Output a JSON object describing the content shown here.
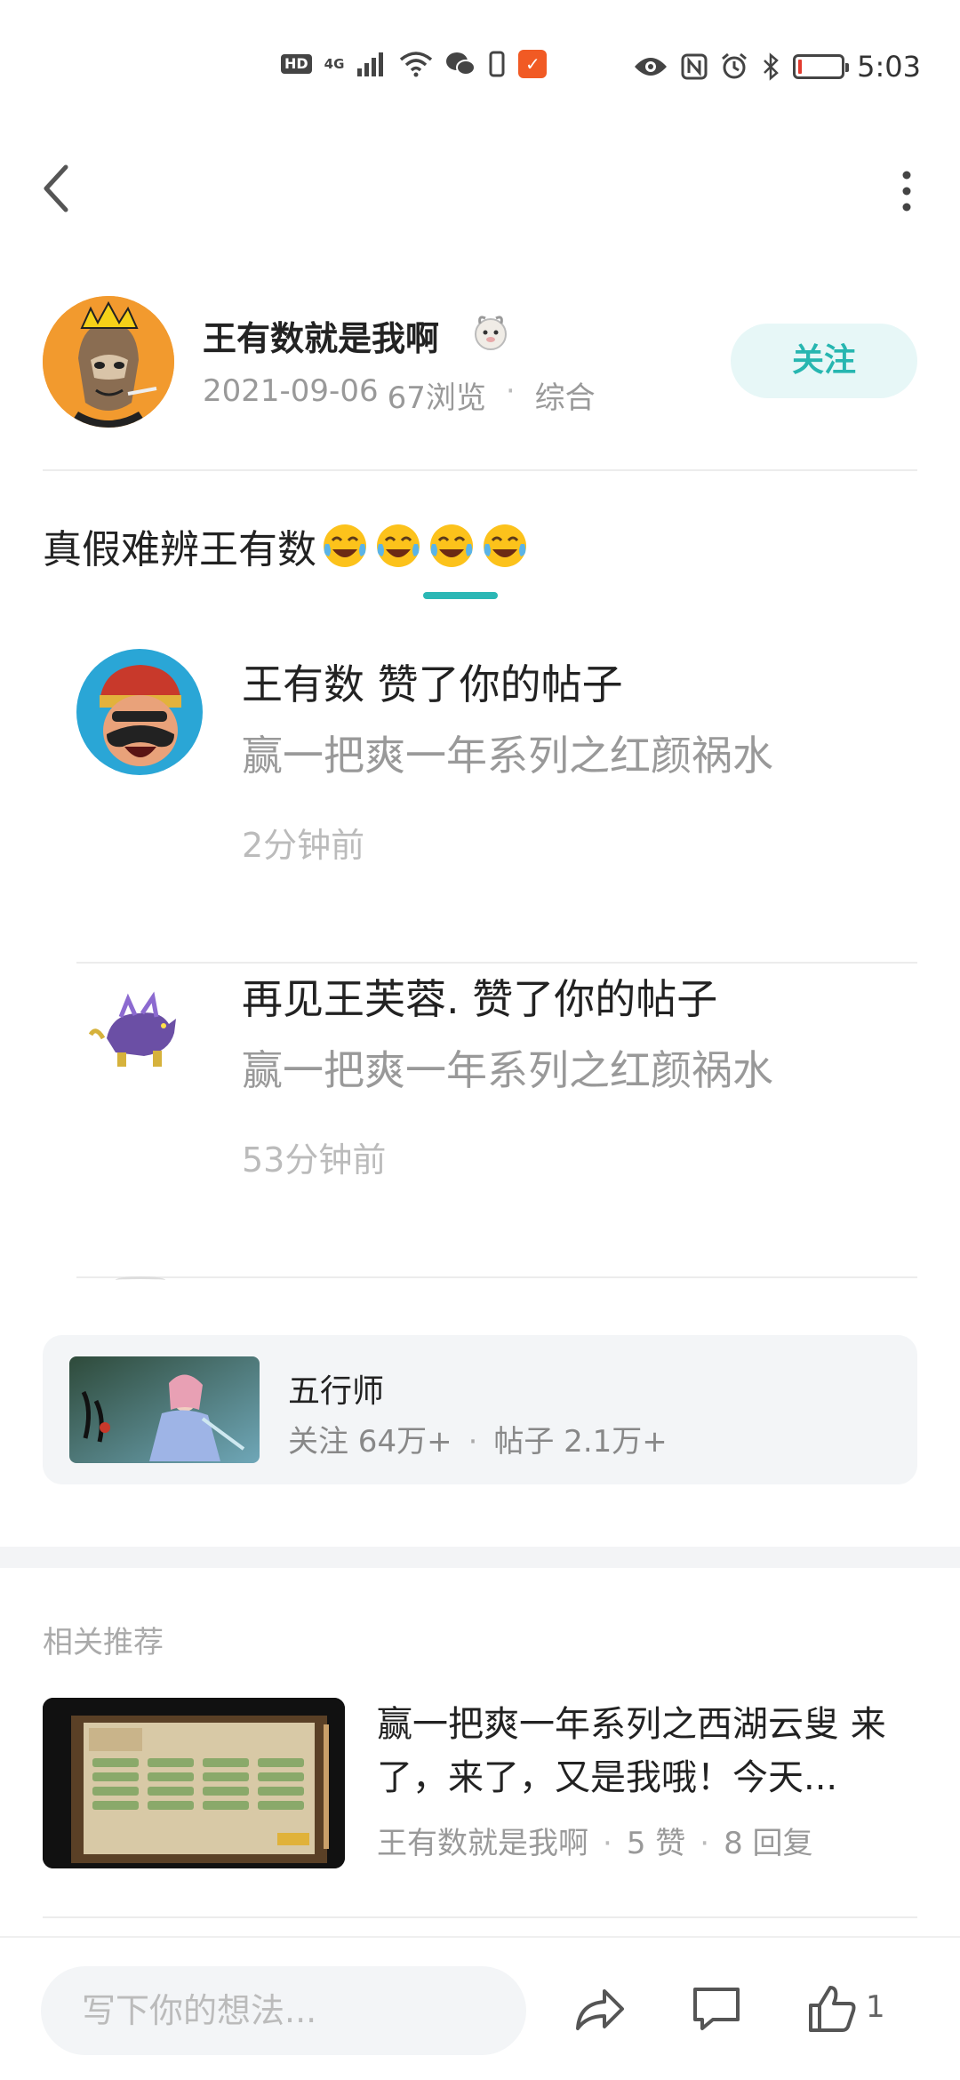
{
  "status_bar": {
    "time": "5:03",
    "hd": "HD",
    "network": "4G"
  },
  "author": {
    "name": "王有数就是我啊",
    "date": "2021-09-06",
    "views": "67浏览",
    "category": "综合",
    "follow_label": "关注"
  },
  "post": {
    "title": "真假难辨王有数"
  },
  "notifications": [
    {
      "title": "王有数 赞了你的帖子",
      "subtitle": "赢一把爽一年系列之红颜祸水",
      "time": "2分钟前"
    },
    {
      "title": "再见王芙蓉. 赞了你的帖子",
      "subtitle": "赢一把爽一年系列之红颜祸水",
      "time": "53分钟前"
    }
  ],
  "circle": {
    "name": "五行师",
    "followers": "关注 64万+",
    "posts": "帖子 2.1万+"
  },
  "related": {
    "label": "相关推荐",
    "items": [
      {
        "title": "赢一把爽一年系列之西湖云叟 来了，来了，又是我哦！今天...",
        "author": "王有数就是我啊",
        "likes": "5 赞",
        "replies": "8 回复"
      }
    ]
  },
  "bottom_bar": {
    "input_placeholder": "写下你的想法...",
    "like_count": "1"
  },
  "colors": {
    "accent": "#2bb7b5",
    "follow_bg": "#e7f7f7"
  }
}
